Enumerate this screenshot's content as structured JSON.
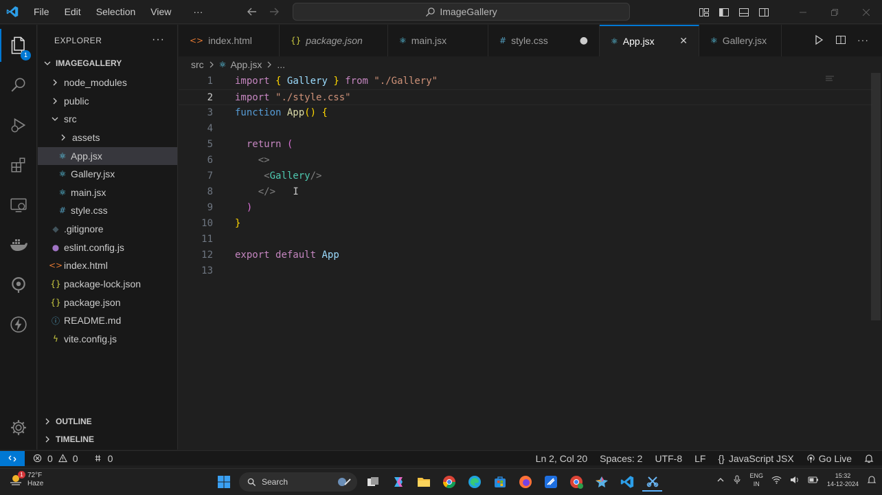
{
  "titlebar": {
    "menu": [
      "File",
      "Edit",
      "Selection",
      "View",
      "···"
    ],
    "command_center": "ImageGallery"
  },
  "activity_bar": {
    "items": [
      "explorer-icon",
      "search-icon",
      "run-debug-icon",
      "extensions-icon",
      "remote-explorer-icon",
      "docker-icon",
      "gitlens-icon",
      "thunder-client-icon"
    ],
    "explorer_badge": "1"
  },
  "sidebar": {
    "title": "EXPLORER",
    "actions": "···",
    "root": "IMAGEGALLERY",
    "tree": [
      {
        "label": "node_modules",
        "type": "folder",
        "icon": "",
        "icon_color": "#cccccc"
      },
      {
        "label": "public",
        "type": "folder",
        "icon": "",
        "icon_color": "#cccccc"
      },
      {
        "label": "src",
        "type": "folder-open",
        "icon": "",
        "icon_color": "#cccccc"
      },
      {
        "label": "assets",
        "type": "folder",
        "icon": "",
        "icon_color": "#cccccc"
      },
      {
        "label": "App.jsx",
        "type": "file",
        "icon": "⚛",
        "icon_color": "#61dafb"
      },
      {
        "label": "Gallery.jsx",
        "type": "file",
        "icon": "⚛",
        "icon_color": "#61dafb"
      },
      {
        "label": "main.jsx",
        "type": "file",
        "icon": "⚛",
        "icon_color": "#61dafb"
      },
      {
        "label": "style.css",
        "type": "file",
        "icon": "#",
        "icon_color": "#519aba"
      },
      {
        "label": ".gitignore",
        "type": "file",
        "icon": "◆",
        "icon_color": "#41535b"
      },
      {
        "label": "eslint.config.js",
        "type": "file",
        "icon": "●",
        "icon_color": "#a074c4"
      },
      {
        "label": "index.html",
        "type": "file",
        "icon": "<>",
        "icon_color": "#e37933"
      },
      {
        "label": "package-lock.json",
        "type": "file",
        "icon": "{}",
        "icon_color": "#cbcb41"
      },
      {
        "label": "package.json",
        "type": "file",
        "icon": "{}",
        "icon_color": "#cbcb41"
      },
      {
        "label": "README.md",
        "type": "file",
        "icon": "ⓘ",
        "icon_color": "#519aba"
      },
      {
        "label": "vite.config.js",
        "type": "file",
        "icon": "ϟ",
        "icon_color": "#cbcb41"
      }
    ],
    "outline": "OUTLINE",
    "timeline": "TIMELINE"
  },
  "tabs": [
    {
      "label": "index.html",
      "icon": "<>",
      "icon_color": "#e37933",
      "italic": false,
      "state": ""
    },
    {
      "label": "package.json",
      "icon": "{}",
      "icon_color": "#cbcb41",
      "italic": true,
      "state": ""
    },
    {
      "label": "main.jsx",
      "icon": "⚛",
      "icon_color": "#61dafb",
      "italic": false,
      "state": ""
    },
    {
      "label": "style.css",
      "icon": "#",
      "icon_color": "#519aba",
      "italic": false,
      "state": "●"
    },
    {
      "label": "App.jsx",
      "icon": "⚛",
      "icon_color": "#61dafb",
      "italic": false,
      "state": "✕"
    },
    {
      "label": "Gallery.jsx",
      "icon": "⚛",
      "icon_color": "#61dafb",
      "italic": false,
      "state": ""
    }
  ],
  "breadcrumb": [
    "src",
    "App.jsx",
    "..."
  ],
  "editor": {
    "current_line": 2,
    "lines": [
      "1",
      "2",
      "3",
      "4",
      "5",
      "6",
      "7",
      "8",
      "9",
      "10",
      "11",
      "12",
      "13"
    ]
  },
  "statusbar": {
    "errors": "0",
    "warnings": "0",
    "ports": "0",
    "position": "Ln 2, Col 20",
    "spaces": "Spaces: 2",
    "encoding": "UTF-8",
    "eol": "LF",
    "language": "JavaScript JSX",
    "golive": "Go Live"
  },
  "taskbar": {
    "temp": "72°F",
    "condition": "Haze",
    "weather_badge": "1",
    "search": "Search",
    "lang_top": "ENG",
    "lang_bottom": "IN",
    "time": "15:32",
    "date": "14-12-2024"
  }
}
